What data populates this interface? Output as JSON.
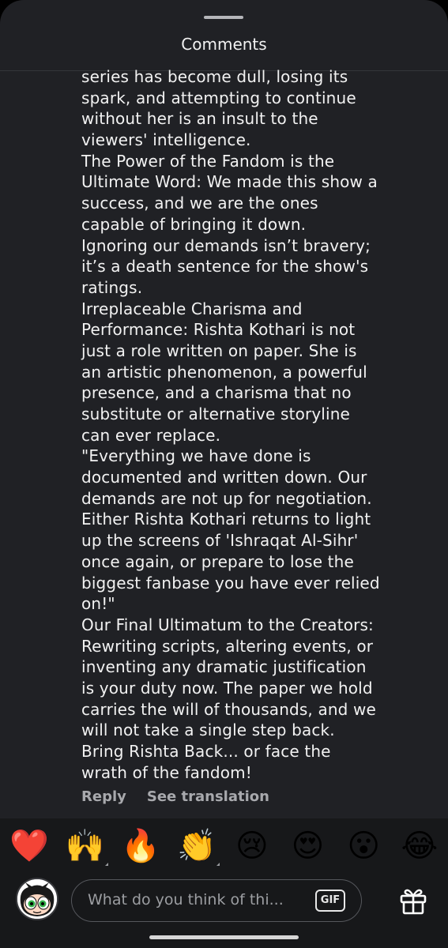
{
  "header": {
    "title": "Comments"
  },
  "comment": {
    "lines": [
      "series has become dull, losing its",
      "spark, and attempting to continue",
      "without her is an insult to the",
      "viewers' intelligence.",
      "The Power of the Fandom is the",
      "Ultimate Word: We made this show a",
      "success, and we are the ones",
      "capable of bringing it down.",
      "Ignoring our demands isn’t bravery;",
      "it’s a death sentence for the show's",
      "ratings.",
      "Irreplaceable Charisma and",
      "Performance: Rishta Kothari is not",
      "just a role written on paper. She is",
      "an artistic phenomenon, a powerful",
      "presence, and a charisma that no",
      "substitute or alternative storyline",
      "can ever replace.",
      "\"Everything we have done is",
      "documented and written down. Our",
      "demands are not up for negotiation.",
      "Either Rishta Kothari returns to light",
      "up the screens of 'Ishraqat Al-Sihr'",
      "once again, or prepare to lose the",
      "biggest fanbase you have ever relied",
      "on!\"",
      "Our Final Ultimatum to the Creators:",
      "Rewriting scripts, altering events, or",
      "inventing any dramatic justification",
      "is your duty now. The paper we hold",
      "carries the will of thousands, and we",
      "will not take a single step back.",
      "Bring Rishta Back... or face the",
      "wrath of the fandom!"
    ],
    "reply_label": "Reply",
    "translate_label": "See translation"
  },
  "reactions": [
    {
      "name": "red-heart-emoji",
      "glyph": "❤️",
      "has_variants": false
    },
    {
      "name": "raising-hands-emoji",
      "glyph": "🙌",
      "has_variants": true
    },
    {
      "name": "fire-emoji",
      "glyph": "🔥",
      "has_variants": false
    },
    {
      "name": "clapping-hands-emoji",
      "glyph": "👏",
      "has_variants": true
    },
    {
      "name": "crying-face-emoji",
      "glyph": "😢",
      "has_variants": false
    },
    {
      "name": "heart-eyes-emoji",
      "glyph": "😍",
      "has_variants": false
    },
    {
      "name": "surprised-face-emoji",
      "glyph": "😮",
      "has_variants": false
    },
    {
      "name": "tears-of-joy-emoji",
      "glyph": "😂",
      "has_variants": false
    }
  ],
  "composer": {
    "placeholder": "What do you think of thi...",
    "gif_label": "GIF",
    "avatar_icon": "cartoon-character-avatar",
    "gift_icon": "gift-icon"
  },
  "colors": {
    "sheet_bg": "#202125",
    "bar_bg": "#17181a",
    "text": "#f2f2f2",
    "muted": "#a8a9ad"
  }
}
